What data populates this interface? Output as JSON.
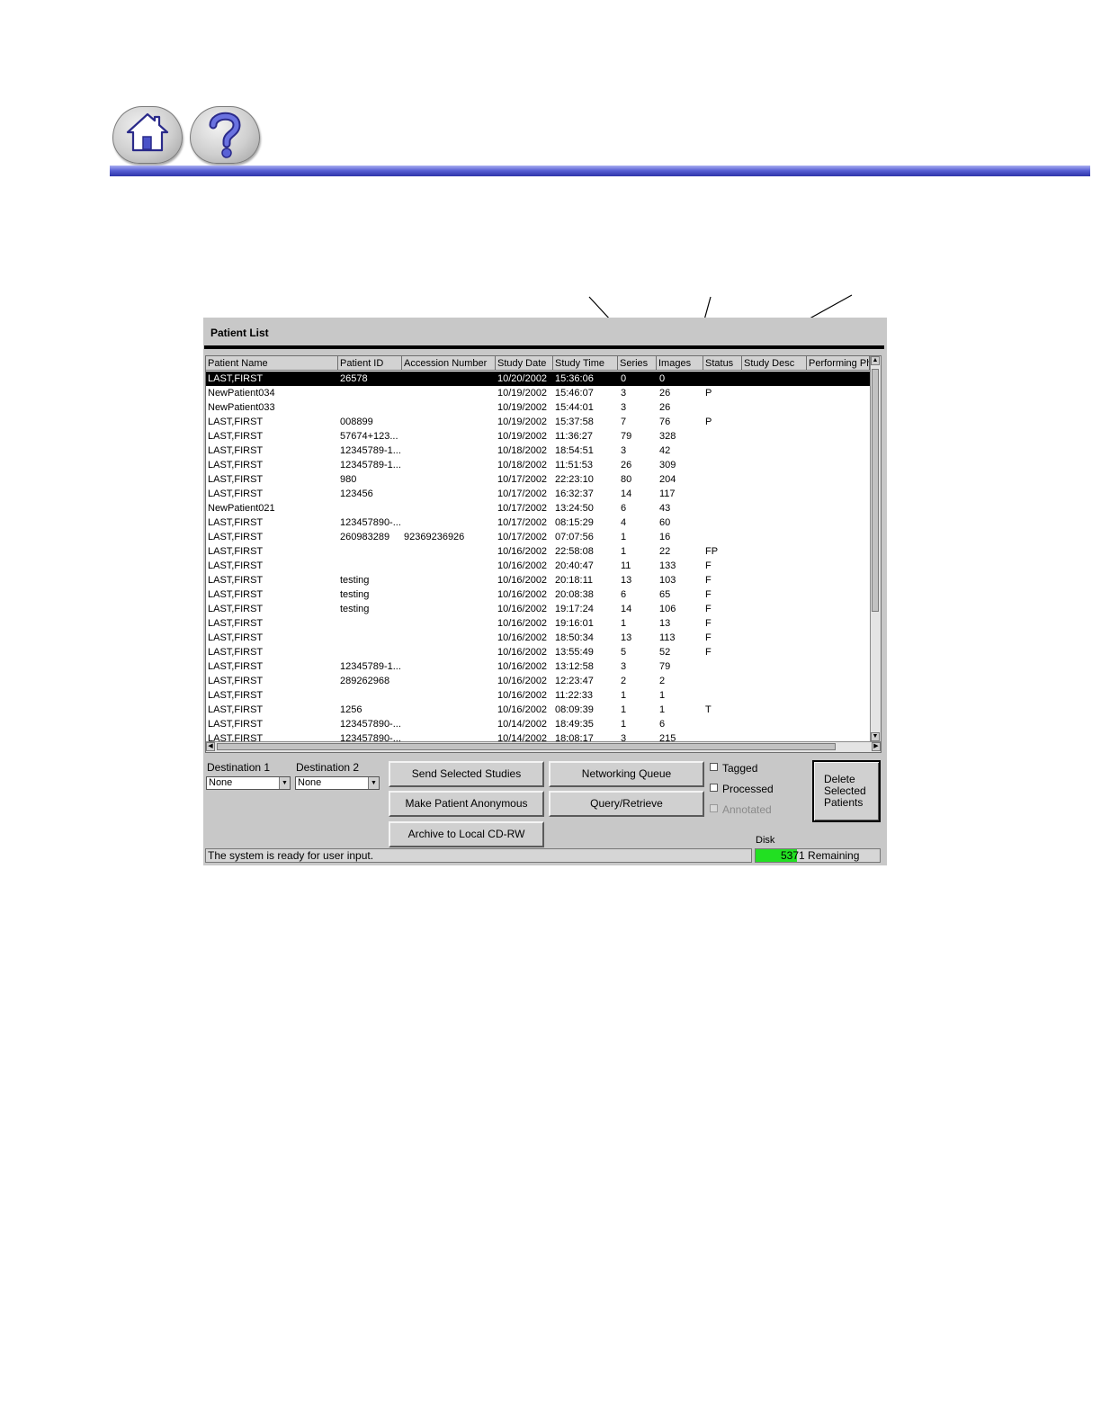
{
  "nav": {
    "home_icon": "home-icon",
    "help_icon": "question-mark-icon"
  },
  "window": {
    "title": "Patient List"
  },
  "table": {
    "columns": [
      "Patient Name",
      "Patient ID",
      "Accession Number",
      "Study Date",
      "Study Time",
      "Series",
      "Images",
      "Status",
      "Study Desc",
      "Performing Ph"
    ],
    "rows": [
      [
        "LAST,FIRST",
        "26578",
        "",
        "10/20/2002",
        "15:36:06",
        "0",
        "0",
        ""
      ],
      [
        "NewPatient034",
        "",
        "",
        "10/19/2002",
        "15:46:07",
        "3",
        "26",
        "P"
      ],
      [
        "NewPatient033",
        "",
        "",
        "10/19/2002",
        "15:44:01",
        "3",
        "26",
        ""
      ],
      [
        "LAST,FIRST",
        "008899",
        "",
        "10/19/2002",
        "15:37:58",
        "7",
        "76",
        "P"
      ],
      [
        "LAST,FIRST",
        "57674+123...",
        "",
        "10/19/2002",
        "11:36:27",
        "79",
        "328",
        ""
      ],
      [
        "LAST,FIRST",
        "12345789-1...",
        "",
        "10/18/2002",
        "18:54:51",
        "3",
        "42",
        ""
      ],
      [
        "LAST,FIRST",
        "12345789-1...",
        "",
        "10/18/2002",
        "11:51:53",
        "26",
        "309",
        ""
      ],
      [
        "LAST,FIRST",
        "980",
        "",
        "10/17/2002",
        "22:23:10",
        "80",
        "204",
        ""
      ],
      [
        "LAST,FIRST",
        "123456",
        "",
        "10/17/2002",
        "16:32:37",
        "14",
        "117",
        ""
      ],
      [
        "NewPatient021",
        "",
        "",
        "10/17/2002",
        "13:24:50",
        "6",
        "43",
        ""
      ],
      [
        "LAST,FIRST",
        "123457890-...",
        "",
        "10/17/2002",
        "08:15:29",
        "4",
        "60",
        ""
      ],
      [
        "LAST,FIRST",
        "260983289",
        "92369236926",
        "10/17/2002",
        "07:07:56",
        "1",
        "16",
        ""
      ],
      [
        "LAST,FIRST",
        "",
        "",
        "10/16/2002",
        "22:58:08",
        "1",
        "22",
        "FP"
      ],
      [
        "LAST,FIRST",
        "",
        "",
        "10/16/2002",
        "20:40:47",
        "11",
        "133",
        "F"
      ],
      [
        "LAST,FIRST",
        "testing",
        "",
        "10/16/2002",
        "20:18:11",
        "13",
        "103",
        "F"
      ],
      [
        "LAST,FIRST",
        "testing",
        "",
        "10/16/2002",
        "20:08:38",
        "6",
        "65",
        "F"
      ],
      [
        "LAST,FIRST",
        "testing",
        "",
        "10/16/2002",
        "19:17:24",
        "14",
        "106",
        "F"
      ],
      [
        "LAST,FIRST",
        "",
        "",
        "10/16/2002",
        "19:16:01",
        "1",
        "13",
        "F"
      ],
      [
        "LAST,FIRST",
        "",
        "",
        "10/16/2002",
        "18:50:34",
        "13",
        "113",
        "F"
      ],
      [
        "LAST,FIRST",
        "",
        "",
        "10/16/2002",
        "13:55:49",
        "5",
        "52",
        "F"
      ],
      [
        "LAST,FIRST",
        "12345789-1...",
        "",
        "10/16/2002",
        "13:12:58",
        "3",
        "79",
        ""
      ],
      [
        "LAST,FIRST",
        "289262968",
        "",
        "10/16/2002",
        "12:23:47",
        "2",
        "2",
        ""
      ],
      [
        "LAST,FIRST",
        "",
        "",
        "10/16/2002",
        "11:22:33",
        "1",
        "1",
        ""
      ],
      [
        "LAST,FIRST",
        "1256",
        "",
        "10/16/2002",
        "08:09:39",
        "1",
        "1",
        "T"
      ],
      [
        "LAST,FIRST",
        "123457890-...",
        "",
        "10/14/2002",
        "18:49:35",
        "1",
        "6",
        ""
      ],
      [
        "LAST,FIRST",
        "123457890-...",
        "",
        "10/14/2002",
        "18:08:17",
        "3",
        "215",
        ""
      ]
    ]
  },
  "controls": {
    "destination1_label": "Destination 1",
    "destination1_value": "None",
    "destination2_label": "Destination 2",
    "destination2_value": "None",
    "send_label": "Send Selected Studies",
    "anonymous_label": "Make Patient Anonymous",
    "archive_label": "Archive to Local CD-RW",
    "networking_label": "Networking Queue",
    "query_label": "Query/Retrieve",
    "tagged_label": "Tagged",
    "processed_label": "Processed",
    "annotated_label": "Annotated",
    "delete_line1": "Delete",
    "delete_line2": "Selected",
    "delete_line3": "Patients"
  },
  "status": {
    "message": "The system is ready for user input.",
    "disk_label": "Disk",
    "disk_text": "5371 Remaining",
    "disk_fill_fraction": 0.33
  }
}
